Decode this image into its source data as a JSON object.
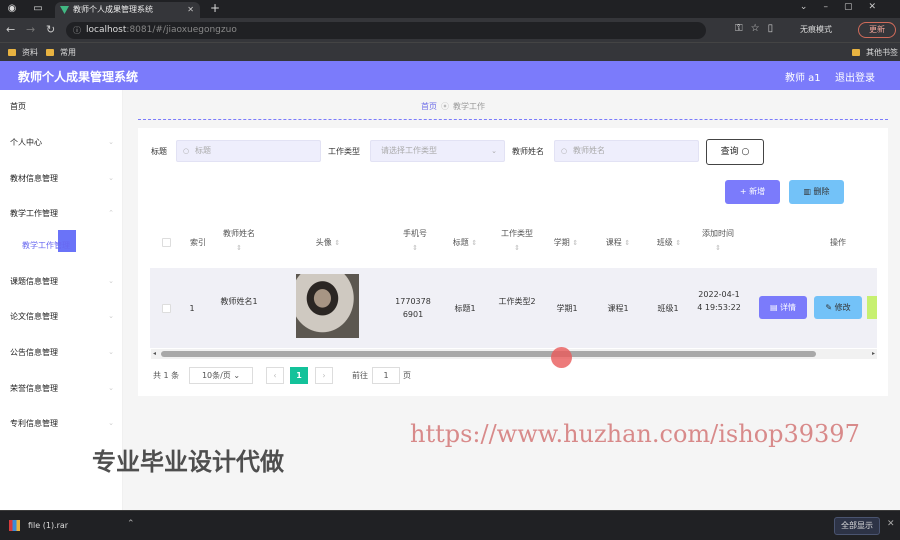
{
  "browser": {
    "tab_title": "教师个人成果管理系统",
    "url_host": "localhost",
    "url_path": ":8081/#/jiaoxuegongzuo",
    "incognito_label": "无痕模式",
    "update_label": "更新",
    "bookmarks": [
      "资料",
      "常用"
    ],
    "other_bookmarks": "其他书签"
  },
  "header": {
    "title": "教师个人成果管理系统",
    "user": "教师 a1",
    "logout": "退出登录"
  },
  "sidebar": {
    "items": [
      {
        "label": "首页"
      },
      {
        "label": "个人中心"
      },
      {
        "label": "教材信息管理"
      },
      {
        "label": "教学工作管理"
      },
      {
        "label": "课题信息管理"
      },
      {
        "label": "论文信息管理"
      },
      {
        "label": "公告信息管理"
      },
      {
        "label": "荣誉信息管理"
      },
      {
        "label": "专利信息管理"
      }
    ],
    "active_sub": "教学工作管理"
  },
  "breadcrumb": {
    "home": "首页",
    "current": "教学工作"
  },
  "search": {
    "title_label": "标题",
    "title_placeholder": "标题",
    "type_label": "工作类型",
    "type_placeholder": "请选择工作类型",
    "teacher_label": "教师姓名",
    "teacher_placeholder": "教师姓名",
    "query_button": "查询"
  },
  "actions": {
    "add": "新增",
    "delete": "删除"
  },
  "table": {
    "headers": {
      "index": "索引",
      "teacher": "教师姓名",
      "avatar": "头像",
      "phone": "手机号",
      "title": "标题",
      "type": "工作类型",
      "semester": "学期",
      "course": "课程",
      "class": "班级",
      "time": "添加时间",
      "ops": "操作"
    },
    "row": {
      "index": "1",
      "teacher": "教师姓名1",
      "phone": "17703786901",
      "title": "标题1",
      "type": "工作类型2",
      "semester": "学期1",
      "course": "课程1",
      "class": "班级1",
      "time": "2022-04-14 19:53:22"
    },
    "row_buttons": {
      "detail": "详情",
      "edit": "修改"
    }
  },
  "pagination": {
    "total": "共 1 条",
    "page_size": "10条/页",
    "current": "1",
    "goto_label": "前往",
    "goto_value": "1",
    "page_unit": "页"
  },
  "watermarks": {
    "url": "https://www.huzhan.com/ishop39397",
    "promo": "专业毕业设计代做"
  },
  "download": {
    "file": "file (1).rar",
    "show_all": "全部显示"
  },
  "colors": {
    "primary": "#7b7bfb",
    "secondary": "#73c2f8",
    "page_active": "#13c29a"
  }
}
